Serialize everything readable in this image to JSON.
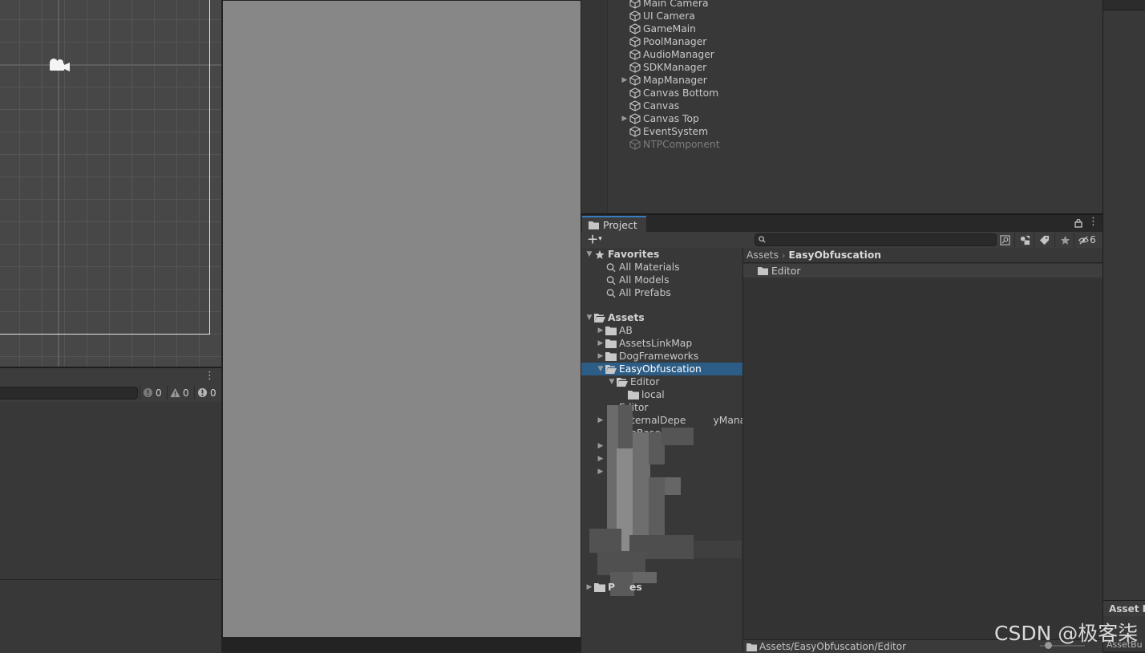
{
  "console": {
    "info_count": "0",
    "warning_count": "0",
    "error_count": "0"
  },
  "hierarchy": {
    "items": [
      {
        "label": "Main Camera",
        "has_children": false,
        "dimmed": false
      },
      {
        "label": "UI Camera",
        "has_children": false,
        "dimmed": false
      },
      {
        "label": "GameMain",
        "has_children": false,
        "dimmed": false
      },
      {
        "label": "PoolManager",
        "has_children": false,
        "dimmed": false
      },
      {
        "label": "AudioManager",
        "has_children": false,
        "dimmed": false
      },
      {
        "label": "SDKManager",
        "has_children": false,
        "dimmed": false
      },
      {
        "label": "MapManager",
        "has_children": true,
        "dimmed": false
      },
      {
        "label": "Canvas Bottom",
        "has_children": false,
        "dimmed": false
      },
      {
        "label": "Canvas",
        "has_children": false,
        "dimmed": false
      },
      {
        "label": "Canvas Top",
        "has_children": true,
        "dimmed": false
      },
      {
        "label": "EventSystem",
        "has_children": false,
        "dimmed": false
      },
      {
        "label": "NTPComponent",
        "has_children": false,
        "dimmed": true
      }
    ]
  },
  "project": {
    "tab_label": "Project",
    "hidden_count": "6",
    "favorites": {
      "label": "Favorites",
      "items": [
        "All Materials",
        "All Models",
        "All Prefabs"
      ]
    },
    "assets_label": "Assets",
    "tree": [
      {
        "label": "AB",
        "depth": 1,
        "arrow": "right",
        "icon": "folder"
      },
      {
        "label": "AssetsLinkMap",
        "depth": 1,
        "arrow": "right",
        "icon": "folder"
      },
      {
        "label": "DogFrameworks",
        "depth": 1,
        "arrow": "right",
        "icon": "folder"
      },
      {
        "label": "EasyObfuscation",
        "depth": 1,
        "arrow": "down",
        "icon": "folder-open",
        "selected": true
      },
      {
        "label": "Editor",
        "depth": 2,
        "arrow": "down",
        "icon": "folder-open"
      },
      {
        "label": "local",
        "depth": 3,
        "arrow": "none",
        "icon": "folder"
      },
      {
        "label": "Editor",
        "depth": 1,
        "arrow": "none",
        "icon": "none"
      },
      {
        "label": "ExternalDepe",
        "label_tail": "yManag",
        "depth": 1,
        "arrow": "right",
        "icon": "none"
      },
      {
        "label": "FireBase",
        "depth": 1,
        "arrow": "none",
        "icon": "none"
      },
      {
        "label": "S",
        "depth": 1,
        "arrow": "right",
        "icon": "none"
      },
      {
        "label": "",
        "depth": 1,
        "arrow": "right",
        "icon": "none"
      },
      {
        "label": "Scri",
        "depth": 1,
        "arrow": "right",
        "icon": "none"
      }
    ],
    "packages_label": "P",
    "packages_tail": "es",
    "breadcrumb": {
      "root": "Assets",
      "current": "EasyObfuscation"
    },
    "content_items": [
      "Editor"
    ],
    "status_path": "Assets/EasyObfuscation/Editor"
  },
  "right_strip": {
    "asset_label": "Asset L",
    "asset_bundle": "AssetBu"
  },
  "watermark": "CSDN @极客柒"
}
